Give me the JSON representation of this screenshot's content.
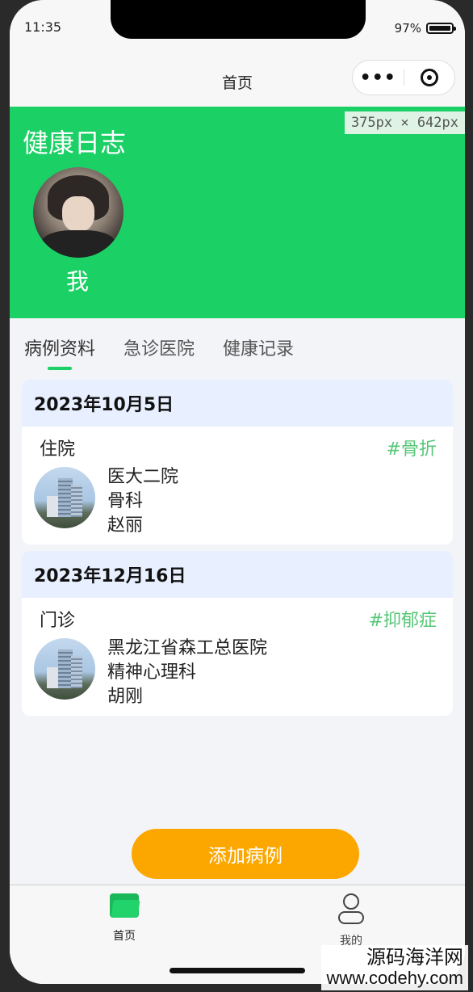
{
  "status_bar": {
    "time": "11:35",
    "battery": "97%"
  },
  "navbar": {
    "title": "首页",
    "more_glyph": "•••"
  },
  "header": {
    "title": "健康日志",
    "user_name": "我",
    "size_badge": "375px × 642px",
    "background_color": "#1bd065"
  },
  "tabs": [
    {
      "label": "病例资料",
      "active": true
    },
    {
      "label": "急诊医院",
      "active": false
    },
    {
      "label": "健康记录",
      "active": false
    }
  ],
  "records": [
    {
      "date": "2023年10月5日",
      "visit_type": "住院",
      "tag": "#骨折",
      "hospital": "医大二院",
      "department": "骨科",
      "doctor": "赵丽"
    },
    {
      "date": "2023年12月16日",
      "visit_type": "门诊",
      "tag": "#抑郁症",
      "hospital": "黑龙江省森工总医院",
      "department": "精神心理科",
      "doctor": "胡刚"
    }
  ],
  "add_button": {
    "label": "添加病例",
    "color": "#fca600"
  },
  "tabbar": [
    {
      "label": "首页",
      "icon": "folder-icon",
      "active": true
    },
    {
      "label": "我的",
      "icon": "person-icon",
      "active": false
    }
  ],
  "watermark": {
    "line1": "源码海洋网",
    "line2": "www.codehy.com"
  },
  "colors": {
    "accent": "#1bd065",
    "tag": "#55c777",
    "date_header_bg": "#e8efff"
  }
}
